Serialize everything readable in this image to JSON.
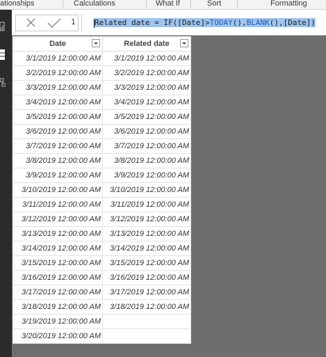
{
  "ribbon": {
    "tabs": [
      "ationships",
      "Calculations",
      "What If",
      "Sort",
      "Formatting"
    ]
  },
  "formula_bar": {
    "line_number": "1",
    "selected_prefix": "Related date = IF([Date]>",
    "fn_today": "TODAY",
    "paren1": "(),",
    "fn_blank": "BLANK",
    "paren2": "(),[Date])",
    "colors": {
      "selection": "#9fc4ee",
      "keyword": "#1f5fc0"
    }
  },
  "table": {
    "columns": [
      "Date",
      "Related date"
    ],
    "rows": [
      [
        "3/1/2019 12:00:00 AM",
        "3/1/2019 12:00:00 AM"
      ],
      [
        "3/2/2019 12:00:00 AM",
        "3/2/2019 12:00:00 AM"
      ],
      [
        "3/3/2019 12:00:00 AM",
        "3/3/2019 12:00:00 AM"
      ],
      [
        "3/4/2019 12:00:00 AM",
        "3/4/2019 12:00:00 AM"
      ],
      [
        "3/5/2019 12:00:00 AM",
        "3/5/2019 12:00:00 AM"
      ],
      [
        "3/6/2019 12:00:00 AM",
        "3/6/2019 12:00:00 AM"
      ],
      [
        "3/7/2019 12:00:00 AM",
        "3/7/2019 12:00:00 AM"
      ],
      [
        "3/8/2019 12:00:00 AM",
        "3/8/2019 12:00:00 AM"
      ],
      [
        "3/9/2019 12:00:00 AM",
        "3/9/2019 12:00:00 AM"
      ],
      [
        "3/10/2019 12:00:00 AM",
        "3/10/2019 12:00:00 AM"
      ],
      [
        "3/11/2019 12:00:00 AM",
        "3/11/2019 12:00:00 AM"
      ],
      [
        "3/12/2019 12:00:00 AM",
        "3/12/2019 12:00:00 AM"
      ],
      [
        "3/13/2019 12:00:00 AM",
        "3/13/2019 12:00:00 AM"
      ],
      [
        "3/14/2019 12:00:00 AM",
        "3/14/2019 12:00:00 AM"
      ],
      [
        "3/15/2019 12:00:00 AM",
        "3/15/2019 12:00:00 AM"
      ],
      [
        "3/16/2019 12:00:00 AM",
        "3/16/2019 12:00:00 AM"
      ],
      [
        "3/17/2019 12:00:00 AM",
        "3/17/2019 12:00:00 AM"
      ],
      [
        "3/18/2019 12:00:00 AM",
        "3/18/2019 12:00:00 AM"
      ],
      [
        "3/19/2019 12:00:00 AM",
        ""
      ],
      [
        "3/20/2019 12:00:00 AM",
        ""
      ]
    ]
  }
}
